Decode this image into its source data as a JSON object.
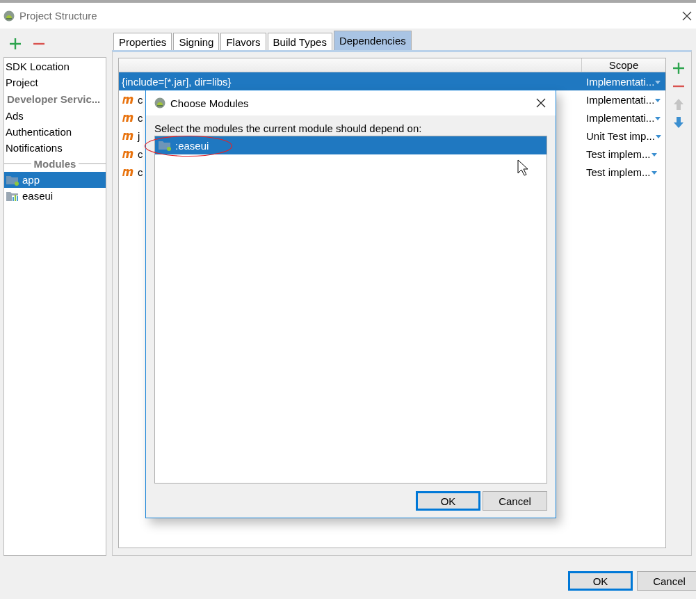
{
  "window": {
    "title": "Project Structure"
  },
  "sidebar": {
    "items": [
      {
        "label": "SDK Location",
        "kind": "item",
        "selected": false
      },
      {
        "label": "Project",
        "kind": "item",
        "selected": false
      },
      {
        "label": "Developer Servic...",
        "kind": "section"
      },
      {
        "label": "Ads",
        "kind": "item",
        "selected": false
      },
      {
        "label": "Authentication",
        "kind": "item",
        "selected": false
      },
      {
        "label": "Notifications",
        "kind": "item",
        "selected": false
      },
      {
        "label": "Modules",
        "kind": "divider"
      },
      {
        "label": "app",
        "kind": "app-module",
        "selected": true
      },
      {
        "label": "easeui",
        "kind": "library-module",
        "selected": false
      }
    ]
  },
  "tabs": [
    {
      "label": "Properties",
      "selected": false
    },
    {
      "label": "Signing",
      "selected": false
    },
    {
      "label": "Flavors",
      "selected": false
    },
    {
      "label": "Build Types",
      "selected": false
    },
    {
      "label": "Dependencies",
      "selected": true
    }
  ],
  "table": {
    "columns": [
      "Scope"
    ],
    "rows": [
      {
        "kind": "file",
        "column_1": "{include=[*.jar], dir=libs}",
        "scope": "Implementati...",
        "selected": true
      },
      {
        "kind": "maven",
        "column_1": "c",
        "scope": "Implementati...",
        "selected": false
      },
      {
        "kind": "maven",
        "column_1": "c",
        "scope": "Implementati...",
        "selected": false
      },
      {
        "kind": "maven",
        "column_1": "j",
        "scope": "Unit Test imp...",
        "selected": false
      },
      {
        "kind": "maven",
        "column_1": "c",
        "scope": "Test implem...",
        "selected": false
      },
      {
        "kind": "maven",
        "column_1": "c",
        "scope": "Test implem...",
        "selected": false
      }
    ]
  },
  "toolbar": [
    {
      "kind": "add",
      "disabled": false
    },
    {
      "kind": "remove",
      "disabled": false
    },
    {
      "kind": "up",
      "disabled": true
    },
    {
      "kind": "down",
      "disabled": false
    }
  ],
  "dialog": {
    "title": "Choose Modules",
    "prompt": "Select the modules the current module should depend on:",
    "modules": [
      {
        "label": ":easeui",
        "selected": true
      }
    ],
    "buttons": [
      {
        "label": "OK",
        "default": true
      },
      {
        "label": "Cancel",
        "default": false
      }
    ]
  },
  "buttons": [
    {
      "label": "OK",
      "default": true
    },
    {
      "label": "Cancel",
      "default": false
    }
  ]
}
